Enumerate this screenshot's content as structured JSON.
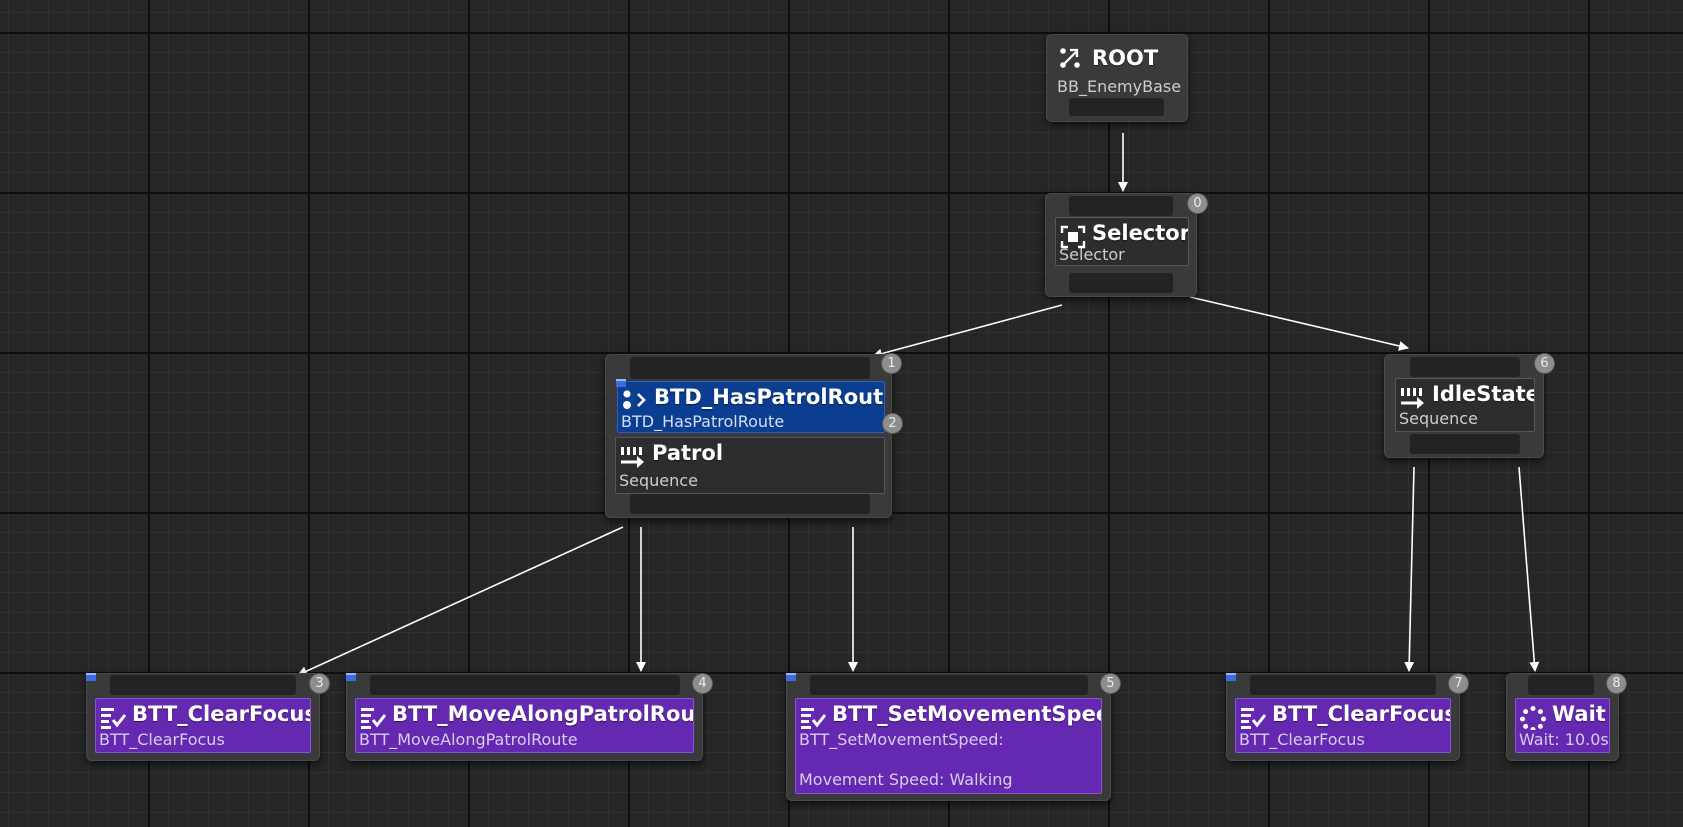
{
  "nodes": {
    "root": {
      "title": "ROOT",
      "subtitle": "BB_EnemyBase",
      "icon": "branch-icon"
    },
    "selector": {
      "title": "Selector",
      "subtitle": "Selector",
      "index": "0",
      "icon": "selector-icon"
    },
    "patrol": {
      "index": "1",
      "decorator": {
        "title": "BTD_HasPatrolRoute",
        "subtitle": "BTD_HasPatrolRoute",
        "index": "2",
        "icon": "decorator-icon"
      },
      "title": "Patrol",
      "subtitle": "Sequence",
      "icon": "sequence-icon"
    },
    "idle": {
      "title": "IdleState",
      "subtitle": "Sequence",
      "index": "6",
      "icon": "sequence-icon"
    },
    "tasks": [
      {
        "title": "BTT_ClearFocus",
        "subtitle": "BTT_ClearFocus",
        "index": "3",
        "icon": "task-icon"
      },
      {
        "title": "BTT_MoveAlongPatrolRoute",
        "subtitle": "BTT_MoveAlongPatrolRoute",
        "index": "4",
        "icon": "task-icon"
      },
      {
        "title": "BTT_SetMovementSpeed",
        "subtitle": "BTT_SetMovementSpeed:",
        "detail": "Movement Speed: Walking",
        "index": "5",
        "icon": "task-icon"
      },
      {
        "title": "BTT_ClearFocus",
        "subtitle": "BTT_ClearFocus",
        "index": "7",
        "icon": "task-icon"
      },
      {
        "title": "Wait",
        "subtitle": "Wait: 10.0s",
        "index": "8",
        "icon": "wait-icon"
      }
    ]
  },
  "colors": {
    "task": "#6429b0",
    "decorator": "#0b3d91",
    "composite": "#2d2d2d",
    "wire": "#ffffff"
  }
}
